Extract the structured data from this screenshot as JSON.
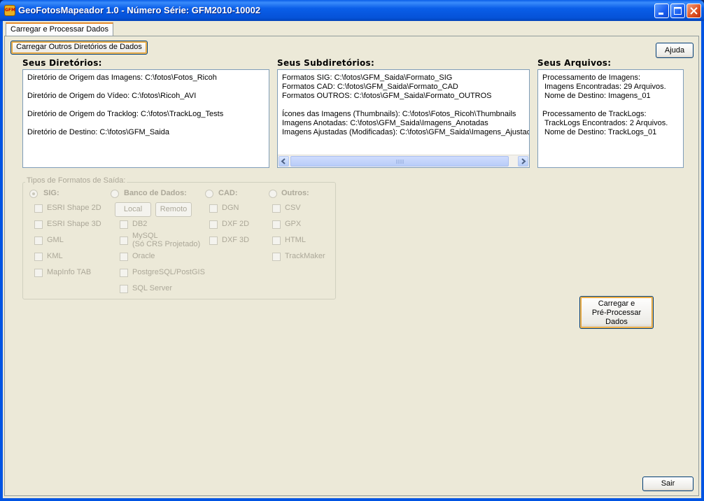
{
  "window": {
    "title": "GeoFotosMapeador 1.0 - Número Série: GFM2010-10002",
    "app_icon_text": "GFM"
  },
  "tabs": [
    {
      "label": "Carregar e Processar Dados",
      "selected": true
    }
  ],
  "toolbar": {
    "load_dirs_label": "Carregar Outros Diretórios de Dados",
    "help_label": "Ajuda"
  },
  "directories": {
    "heading": "Seus Diretórios:",
    "lines": [
      "Diretório de Origem das Imagens: C:\\fotos\\Fotos_Ricoh",
      "Diretório de Origem do Vídeo: C:\\fotos\\Ricoh_AVI",
      "Diretório de Origem do Tracklog: C:\\fotos\\TrackLog_Tests",
      "Diretório de Destino: C:\\fotos\\GFM_Saida"
    ]
  },
  "subdirectories": {
    "heading": "Seus Subdiretórios:",
    "lines": [
      "Formatos SIG: C:\\fotos\\GFM_Saida\\Formato_SIG",
      "Formatos CAD: C:\\fotos\\GFM_Saida\\Formato_CAD",
      "Formatos OUTROS: C:\\fotos\\GFM_Saida\\Formato_OUTROS",
      "Ícones das Imagens (Thumbnails): C:\\fotos\\Fotos_Ricoh\\Thumbnails",
      "Imagens Anotadas: C:\\fotos\\GFM_Saida\\Imagens_Anotadas",
      "Imagens Ajustadas (Modificadas): C:\\fotos\\GFM_Saida\\Imagens_Ajustadas"
    ]
  },
  "files": {
    "heading": "Seus Arquivos:",
    "lines": [
      "Processamento de Imagens:",
      "Imagens Encontradas: 29 Arquivos.",
      "Nome de Destino: Imagens_01",
      "Processamento de TrackLogs:",
      "TrackLogs Encontrados: 2 Arquivos.",
      "Nome de Destino: TrackLogs_01"
    ]
  },
  "output_formats": {
    "legend": "Tipos de Formatos de Saída:",
    "sig": {
      "label": "SIG:",
      "selected": true,
      "options": [
        "ESRI Shape 2D",
        "ESRI Shape 3D",
        "GML",
        "KML",
        "MapInfo TAB"
      ]
    },
    "db": {
      "label": "Banco de Dados:",
      "local_label": "Local",
      "remote_label": "Remoto",
      "options": [
        "DB2",
        "MySQL",
        "(Só CRS Projetado)",
        "Oracle",
        "PostgreSQL/PostGIS",
        "SQL Server"
      ]
    },
    "cad": {
      "label": "CAD:",
      "options": [
        "DGN",
        "DXF 2D",
        "DXF 3D"
      ]
    },
    "outros": {
      "label": "Outros:",
      "options": [
        "CSV",
        "GPX",
        "HTML",
        "TrackMaker"
      ]
    }
  },
  "actions": {
    "preprocess_lines": [
      "Carregar e",
      "Pré-Processar",
      "Dados"
    ],
    "exit_label": "Sair"
  },
  "colors": {
    "title_bar": "#0a5ee8",
    "tab_accent": "#e68b2c",
    "disabled_text": "#aca899"
  }
}
